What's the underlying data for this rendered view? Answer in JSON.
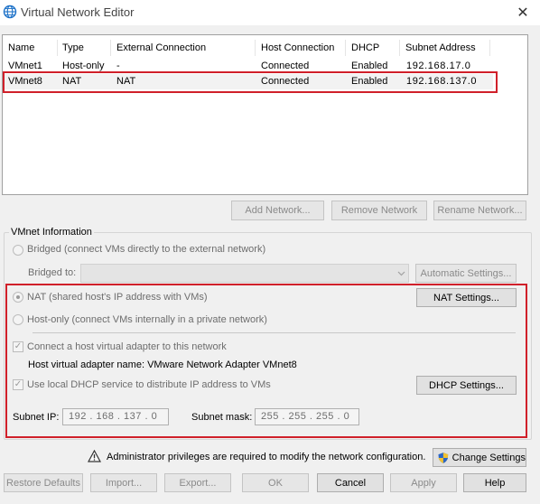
{
  "window": {
    "title": "Virtual Network Editor",
    "icon": "globe-icon",
    "close_glyph": "✕"
  },
  "table": {
    "columns": [
      "Name",
      "Type",
      "External Connection",
      "Host Connection",
      "DHCP",
      "Subnet Address"
    ],
    "rows": [
      {
        "name": "VMnet1",
        "type": "Host-only",
        "external": "-",
        "host": "Connected",
        "dhcp": "Enabled",
        "subnet": "192.168.17.0"
      },
      {
        "name": "VMnet8",
        "type": "NAT",
        "external": "NAT",
        "host": "Connected",
        "dhcp": "Enabled",
        "subnet": "192.168.137.0"
      }
    ]
  },
  "list_buttons": {
    "add": "Add Network...",
    "remove": "Remove Network",
    "rename": "Rename Network..."
  },
  "vmnet_info": {
    "group_label": "VMnet Information",
    "bridged": "Bridged (connect VMs directly to the external network)",
    "bridged_to": "Bridged to:",
    "auto_settings": "Automatic Settings...",
    "nat": "NAT (shared host's IP address with VMs)",
    "nat_settings": "NAT Settings...",
    "hostonly": "Host-only (connect VMs internally in a private network)",
    "connect_adapter": "Connect a host virtual adapter to this network",
    "adapter_name": "Host virtual adapter name: VMware Network Adapter VMnet8",
    "use_dhcp": "Use local DHCP service to distribute IP address to VMs",
    "dhcp_settings": "DHCP Settings...",
    "subnet_ip_label": "Subnet IP:",
    "subnet_ip": "192 . 168 . 137 .  0",
    "subnet_mask_label": "Subnet mask:",
    "subnet_mask": "255 . 255 . 255 .  0"
  },
  "admin": {
    "warning": "Administrator privileges are required to modify the network configuration.",
    "change_settings": "Change Settings"
  },
  "footer": {
    "restore": "Restore Defaults",
    "import": "Import...",
    "export": "Export...",
    "ok": "OK",
    "cancel": "Cancel",
    "apply": "Apply",
    "help": "Help"
  },
  "colors": {
    "highlight_border": "#d0202a",
    "accent": "#1e72c8"
  }
}
